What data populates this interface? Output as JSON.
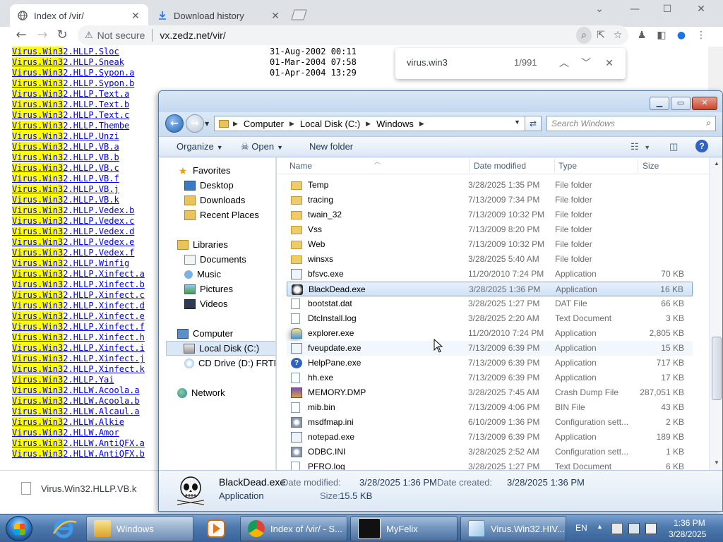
{
  "browser": {
    "tabs": [
      {
        "title": "Index of /vir/",
        "active": true
      },
      {
        "title": "Download history",
        "active": false
      }
    ],
    "address": {
      "warning": "Not secure",
      "url": "vx.zedz.net/vir/"
    },
    "find": {
      "query": "virus.win3",
      "count": "1/991"
    },
    "download_bar": {
      "filename": "Virus.Win32.HLLP.VB.k"
    },
    "highlight": "Virus.Win3",
    "listing": [
      {
        "name": "2.HLLP.Sloc",
        "date": "31-Aug-2002 00:11",
        "size": ""
      },
      {
        "name": "2.HLLP.Sneak",
        "date": "01-Mar-2004 07:58",
        "size": ""
      },
      {
        "name": "2.HLLP.Sypon.a",
        "date": "01-Apr-2004 13:29",
        "size": ""
      },
      {
        "name": "2.HLLP.Sypon.b",
        "date": "",
        "size": ""
      },
      {
        "name": "2.HLLP.Text.a",
        "date": "",
        "size": ""
      },
      {
        "name": "2.HLLP.Text.b",
        "date": "",
        "size": ""
      },
      {
        "name": "2.HLLP.Text.c",
        "date": "",
        "size": ""
      },
      {
        "name": "2.HLLP.Thembe",
        "date": "",
        "size": ""
      },
      {
        "name": "2.HLLP.Unzi",
        "date": "",
        "size": ""
      },
      {
        "name": "2.HLLP.VB.a",
        "date": "",
        "size": ""
      },
      {
        "name": "2.HLLP.VB.b",
        "date": "",
        "size": ""
      },
      {
        "name": "2.HLLP.VB.c",
        "date": "",
        "size": ""
      },
      {
        "name": "2.HLLP.VB.f",
        "date": "",
        "size": ""
      },
      {
        "name": "2.HLLP.VB.j",
        "date": "",
        "size": ""
      },
      {
        "name": "2.HLLP.VB.k",
        "date": "",
        "size": ""
      },
      {
        "name": "2.HLLP.Vedex.b",
        "date": "",
        "size": ""
      },
      {
        "name": "2.HLLP.Vedex.c",
        "date": "",
        "size": ""
      },
      {
        "name": "2.HLLP.Vedex.d",
        "date": "",
        "size": ""
      },
      {
        "name": "2.HLLP.Vedex.e",
        "date": "",
        "size": ""
      },
      {
        "name": "2.HLLP.Vedex.f",
        "date": "",
        "size": ""
      },
      {
        "name": "2.HLLP.Winfig",
        "date": "",
        "size": ""
      },
      {
        "name": "2.HLLP.Xinfect.a",
        "date": "",
        "size": ""
      },
      {
        "name": "2.HLLP.Xinfect.b",
        "date": "",
        "size": ""
      },
      {
        "name": "2.HLLP.Xinfect.c",
        "date": "",
        "size": ""
      },
      {
        "name": "2.HLLP.Xinfect.d",
        "date": "",
        "size": ""
      },
      {
        "name": "2.HLLP.Xinfect.e",
        "date": "",
        "size": ""
      },
      {
        "name": "2.HLLP.Xinfect.f",
        "date": "",
        "size": ""
      },
      {
        "name": "2.HLLP.Xinfect.h",
        "date": "",
        "size": ""
      },
      {
        "name": "2.HLLP.Xinfect.i",
        "date": "",
        "size": ""
      },
      {
        "name": "2.HLLP.Xinfect.j",
        "date": "",
        "size": ""
      },
      {
        "name": "2.HLLP.Xinfect.k",
        "date": "",
        "size": ""
      },
      {
        "name": "2.HLLP.Yai",
        "date": "",
        "size": ""
      },
      {
        "name": "2.HLLW.Acoola.a",
        "date": "",
        "size": ""
      },
      {
        "name": "2.HLLW.Acoola.b",
        "date": "",
        "size": ""
      },
      {
        "name": "2.HLLW.Alcaul.a",
        "date": "",
        "size": ""
      },
      {
        "name": "2.HLLW.Alkie",
        "date": "",
        "size": ""
      },
      {
        "name": "2.HLLW.Amor",
        "date": "",
        "size": ""
      },
      {
        "name": "2.HLLW.AntiQFX.a",
        "date": "",
        "size": ""
      },
      {
        "name": "2.HLLW.AntiQFX.b",
        "date": "",
        "size": ""
      }
    ]
  },
  "explorer": {
    "breadcrumb": [
      "Computer",
      "Local Disk (C:)",
      "Windows"
    ],
    "search_placeholder": "Search Windows",
    "commands": {
      "organize": "Organize",
      "open": "Open",
      "new_folder": "New folder"
    },
    "nav": {
      "favorites": "Favorites",
      "desktop": "Desktop",
      "downloads": "Downloads",
      "recent": "Recent Places",
      "libraries": "Libraries",
      "documents": "Documents",
      "music": "Music",
      "pictures": "Pictures",
      "videos": "Videos",
      "computer": "Computer",
      "local_disk": "Local Disk (C:)",
      "cd_drive": "CD Drive (D:) FRTME",
      "network": "Network"
    },
    "columns": {
      "name": "Name",
      "date": "Date modified",
      "type": "Type",
      "size": "Size"
    },
    "files": [
      {
        "name": "Temp",
        "date": "3/28/2025 1:35 PM",
        "type": "File folder",
        "size": "",
        "icon": "folder"
      },
      {
        "name": "tracing",
        "date": "7/13/2009 7:34 PM",
        "type": "File folder",
        "size": "",
        "icon": "folder"
      },
      {
        "name": "twain_32",
        "date": "7/13/2009 10:32 PM",
        "type": "File folder",
        "size": "",
        "icon": "folder"
      },
      {
        "name": "Vss",
        "date": "7/13/2009 8:20 PM",
        "type": "File folder",
        "size": "",
        "icon": "folder"
      },
      {
        "name": "Web",
        "date": "7/13/2009 10:32 PM",
        "type": "File folder",
        "size": "",
        "icon": "folder"
      },
      {
        "name": "winsxs",
        "date": "3/28/2025 5:40 AM",
        "type": "File folder",
        "size": "",
        "icon": "folder"
      },
      {
        "name": "bfsvc.exe",
        "date": "11/20/2010 7:24 PM",
        "type": "Application",
        "size": "70 KB",
        "icon": "app"
      },
      {
        "name": "BlackDead.exe",
        "date": "3/28/2025 1:36 PM",
        "type": "Application",
        "size": "16 KB",
        "icon": "skull"
      },
      {
        "name": "bootstat.dat",
        "date": "3/28/2025 1:27 PM",
        "type": "DAT File",
        "size": "66 KB",
        "icon": "doc"
      },
      {
        "name": "DtcInstall.log",
        "date": "3/28/2025 2:20 AM",
        "type": "Text Document",
        "size": "3 KB",
        "icon": "doc"
      },
      {
        "name": "explorer.exe",
        "date": "11/20/2010 7:24 PM",
        "type": "Application",
        "size": "2,805 KB",
        "icon": "explorer"
      },
      {
        "name": "fveupdate.exe",
        "date": "7/13/2009 6:39 PM",
        "type": "Application",
        "size": "15 KB",
        "icon": "app"
      },
      {
        "name": "HelpPane.exe",
        "date": "7/13/2009 6:39 PM",
        "type": "Application",
        "size": "717 KB",
        "icon": "help"
      },
      {
        "name": "hh.exe",
        "date": "7/13/2009 6:39 PM",
        "type": "Application",
        "size": "17 KB",
        "icon": "doc"
      },
      {
        "name": "MEMORY.DMP",
        "date": "3/28/2025 7:45 AM",
        "type": "Crash Dump File",
        "size": "287,051 KB",
        "icon": "memory"
      },
      {
        "name": "mib.bin",
        "date": "7/13/2009 4:06 PM",
        "type": "BIN File",
        "size": "43 KB",
        "icon": "doc"
      },
      {
        "name": "msdfmap.ini",
        "date": "6/10/2009 1:36 PM",
        "type": "Configuration sett...",
        "size": "2 KB",
        "icon": "gear"
      },
      {
        "name": "notepad.exe",
        "date": "7/13/2009 6:39 PM",
        "type": "Application",
        "size": "189 KB",
        "icon": "app"
      },
      {
        "name": "ODBC.INI",
        "date": "3/28/2025 2:52 AM",
        "type": "Configuration sett...",
        "size": "1 KB",
        "icon": "gear"
      },
      {
        "name": "PFRO.log",
        "date": "3/28/2025 1:27 PM",
        "type": "Text Document",
        "size": "6 KB",
        "icon": "doc"
      }
    ],
    "details": {
      "name": "BlackDead.exe",
      "type": "Application",
      "modified_label": "Date modified:",
      "modified": "3/28/2025 1:36 PM",
      "created_label": "Date created:",
      "created": "3/28/2025 1:36 PM",
      "size_label": "Size:",
      "size": "15.5 KB"
    }
  },
  "taskbar": {
    "buttons": [
      {
        "label": "Windows",
        "active": true
      },
      {
        "label": "Index of /vir/ - S...",
        "active": false
      },
      {
        "label": "MyFelix",
        "active": false
      },
      {
        "label": "Virus.Win32.HIV....",
        "active": false
      }
    ],
    "lang": "EN",
    "time": "1:36 PM",
    "date": "3/28/2025"
  }
}
